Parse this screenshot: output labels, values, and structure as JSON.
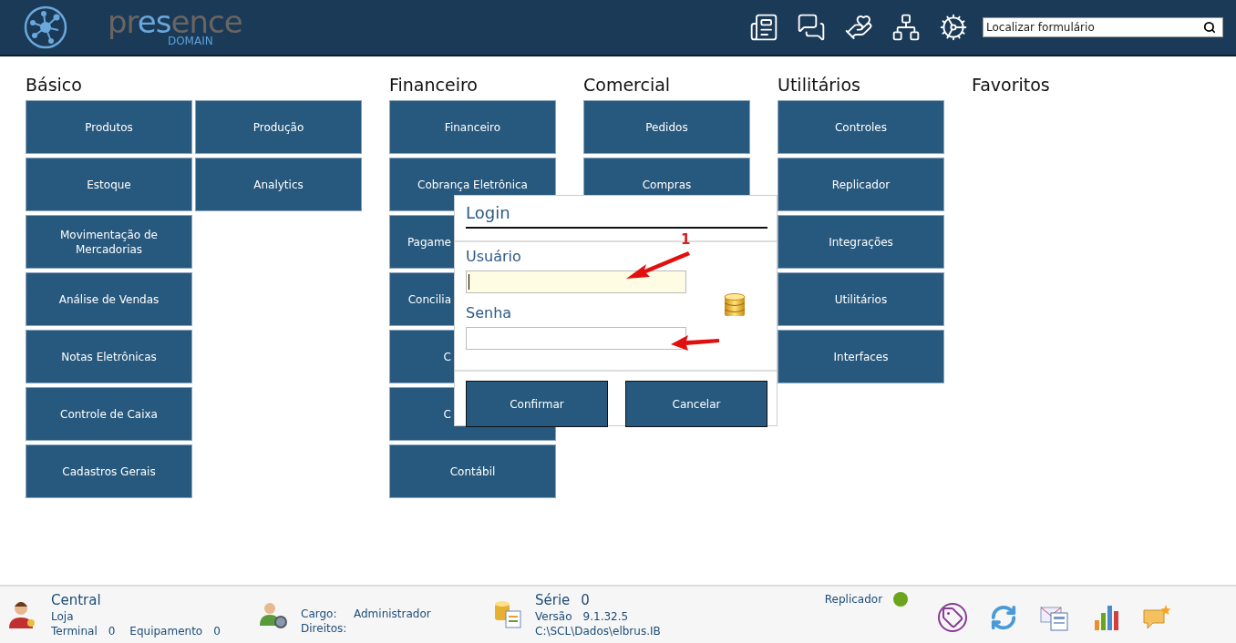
{
  "header": {
    "logo": {
      "parts": [
        {
          "text": "pr",
          "accent": false
        },
        {
          "text": "es",
          "accent": true
        },
        {
          "text": "ence",
          "accent": false
        }
      ],
      "subtitle": "DOMAIN"
    },
    "tools": [
      {
        "kind": "news"
      },
      {
        "kind": "help"
      },
      {
        "kind": "team"
      },
      {
        "kind": "network"
      },
      {
        "kind": "settings"
      }
    ],
    "search": {
      "placeholder": "Localizar formulário"
    }
  },
  "sections": [
    {
      "title": "Básico",
      "columns": [
        [
          "Produtos",
          "Estoque",
          "Movimentação de Mercadorias",
          "Análise de Vendas",
          "Notas Eletrônicas",
          "Controle de Caixa",
          "Cadastros Gerais"
        ],
        [
          "Produção",
          "Analytics"
        ]
      ]
    },
    {
      "title": "Financeiro",
      "columns": [
        [
          "Financeiro",
          "Cobrança Eletrônica",
          "Pagame",
          "Concilia",
          "C",
          "C",
          "Contábil"
        ]
      ]
    },
    {
      "title": "Comercial",
      "columns": [
        [
          "Pedidos",
          "Compras"
        ]
      ]
    },
    {
      "title": "Utilitários",
      "columns": [
        [
          "Controles",
          "Replicador",
          "Integrações",
          "Utilitários",
          "Interfaces"
        ]
      ]
    },
    {
      "title": "Favoritos"
    }
  ],
  "dialog": {
    "title": "Login",
    "step": "1",
    "fields": [
      {
        "label": "Usuário",
        "focused": true
      },
      {
        "label": "Senha",
        "focused": false
      }
    ],
    "buttons": [
      "Confirmar",
      "Cancelar"
    ]
  },
  "status_bar": {
    "user": {
      "title": "Central",
      "store": "Loja",
      "terminal_label": "Terminal",
      "terminal": "0",
      "device_label": "Equipamento",
      "device": "0"
    },
    "role": {
      "role_label": "Cargo:",
      "role": "Administrador",
      "rights_label": "Direitos:"
    },
    "system": {
      "serie_label": "Série",
      "serie": "0",
      "version_label": "Versão",
      "version": "9.1.32.5",
      "path": "C:\\SCL\\Dados\\elbrus.IB"
    },
    "replicator": {
      "label": "Replicador",
      "color": "#6aa51c"
    },
    "actions": [
      {
        "kind": "tag"
      },
      {
        "kind": "sync"
      },
      {
        "kind": "mail"
      },
      {
        "kind": "chart"
      },
      {
        "kind": "message"
      }
    ]
  }
}
